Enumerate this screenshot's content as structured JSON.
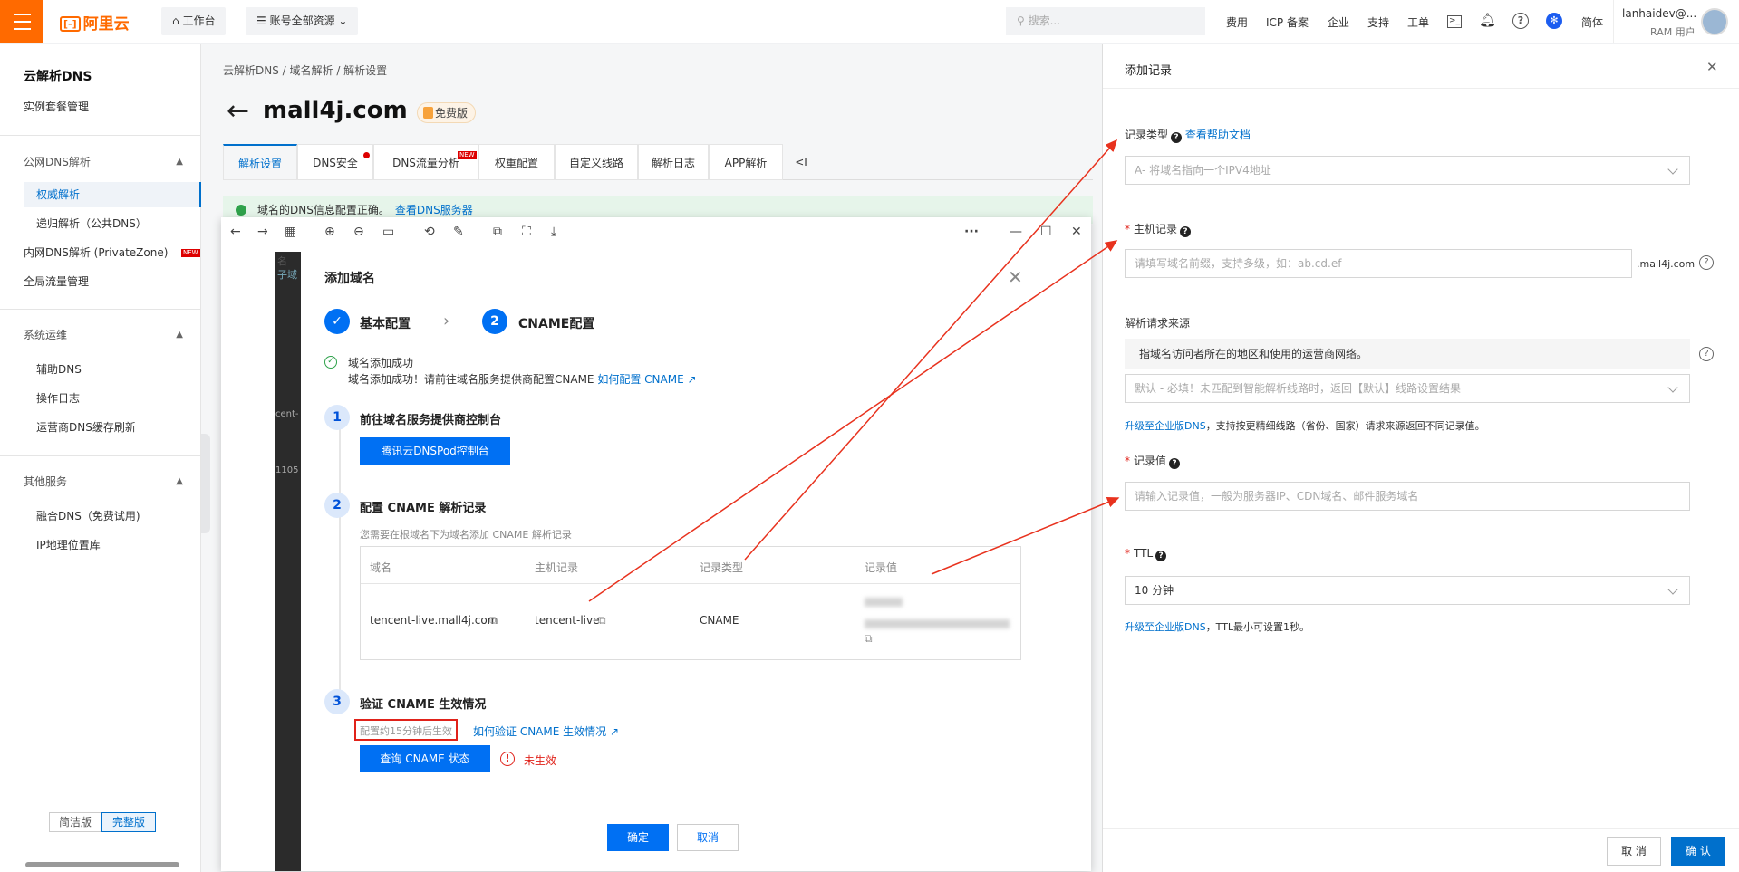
{
  "topbar": {
    "logo": "阿里云",
    "workbench": "工作台",
    "account": "账号全部资源",
    "search_placeholder": "搜索...",
    "links": [
      "费用",
      "ICP 备案",
      "企业",
      "支持",
      "工单"
    ],
    "lang": "简体",
    "user": "lanhaidev@...",
    "user_role": "RAM 用户"
  },
  "sidebar": {
    "title": "云解析DNS",
    "instance": "实例套餐管理",
    "public": "公网DNS解析",
    "auth": "权威解析",
    "recursive": "递归解析（公共DNS）",
    "intranet": "内网DNS解析 (PrivateZone)",
    "intranet_badge": "NEW",
    "gtm": "全局流量管理",
    "ops": "系统运维",
    "aux": "辅助DNS",
    "oplog": "操作日志",
    "isp": "运营商DNS缓存刷新",
    "other": "其他服务",
    "fusion": "融合DNS（免费试用)",
    "ip": "IP地理位置库",
    "simple": "简洁版",
    "full": "完整版"
  },
  "main": {
    "crumbs": "云解析DNS  /  域名解析  /  解析设置",
    "domain": "mall4j.com",
    "plan": "免费版",
    "tabs": [
      "解析设置",
      "DNS安全",
      "DNS流量分析",
      "权重配置",
      "自定义线路",
      "解析日志",
      "APP解析",
      "<I"
    ],
    "tab_new": "NEW",
    "notice": "域名的DNS信息配置正确。",
    "notice_link": "查看DNS服务器"
  },
  "dialog": {
    "title": "添加域名",
    "step1": "基本配置",
    "step2_num": "2",
    "step2": "CNAME配置",
    "success": "域名添加成功",
    "success_desc": "域名添加成功！请前往域名服务提供商配置CNAME",
    "howto": "如何配置 CNAME",
    "s1_num": "1",
    "s1": "前往域名服务提供商控制台",
    "s1_btn": "腾讯云DNSPod控制台",
    "s2_num": "2",
    "s2": "配置 CNAME 解析记录",
    "s2_desc": "您需要在根域名下为域名添加 CNAME 解析记录",
    "cols": [
      "域名",
      "主机记录",
      "记录类型",
      "记录值"
    ],
    "row": {
      "domain": "tencent-live.mall4j.com",
      "host": "tencent-live",
      "type": "CNAME"
    },
    "s3_num": "3",
    "s3": "验证 CNAME 生效情况",
    "s3_note": "配置约15分钟后生效",
    "s3_link": "如何验证 CNAME 生效情况",
    "s3_btn": "查询 CNAME 状态",
    "status": "未生效",
    "ok": "确定",
    "cancel": "取消",
    "bg_frag": [
      "名",
      "子域",
      "cent-",
      "1105"
    ]
  },
  "panel": {
    "title": "添加记录",
    "type_label": "记录类型",
    "help": "查看帮助文档",
    "type_value": "A- 将域名指向一个IPV4地址",
    "host_label": "主机记录",
    "host_placeholder": "请填写域名前缀，支持多级，如：ab.cd.ef",
    "host_suffix": ".mall4j.com",
    "source_label": "解析请求来源",
    "source_tip": "指域名访问者所在的地区和使用的运营商网络。",
    "source_value": "默认 - 必填！未匹配到智能解析线路时，返回【默认】线路设置结果",
    "upgrade1": "升级至企业版DNS",
    "upgrade1_rest": "，支持按更精细线路（省份、国家）请求来源返回不同记录值。",
    "value_label": "记录值",
    "value_placeholder": "请输入记录值，一般为服务器IP、CDN域名、邮件服务域名",
    "ttl_label": "TTL",
    "ttl_value": "10 分钟",
    "upgrade2": "升级至企业版DNS",
    "upgrade2_rest": "，TTL最小可设置1秒。",
    "cancel": "取 消",
    "confirm": "确 认"
  }
}
